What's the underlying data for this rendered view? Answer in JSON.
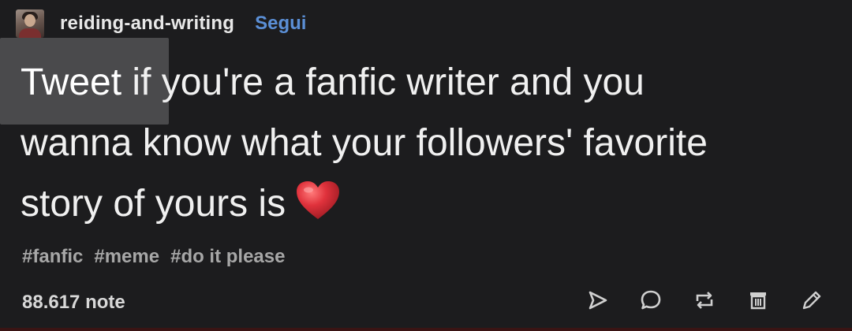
{
  "post": {
    "username": "reiding-and-writing",
    "follow_label": "Segui",
    "body": {
      "highlighted_word": "Tweet",
      "line1_rest": " if you're a fanfic writer and you",
      "line2": "wanna know what your followers' favorite",
      "line3": "story of yours is"
    },
    "tags": [
      "#fanfic",
      "#meme",
      "#do it please"
    ],
    "notes": "88.617 note",
    "icons": {
      "avatar": "avatar",
      "emoji": "red-heart-icon",
      "actions": [
        "share-icon",
        "reply-icon",
        "reblog-icon",
        "delete-icon",
        "edit-icon"
      ]
    },
    "colors": {
      "background": "#1c1c1e",
      "follow": "#5b8fd6",
      "highlight": "#4a4a4c",
      "heart": "#e0323c",
      "tags": "#a7a7a7"
    }
  }
}
